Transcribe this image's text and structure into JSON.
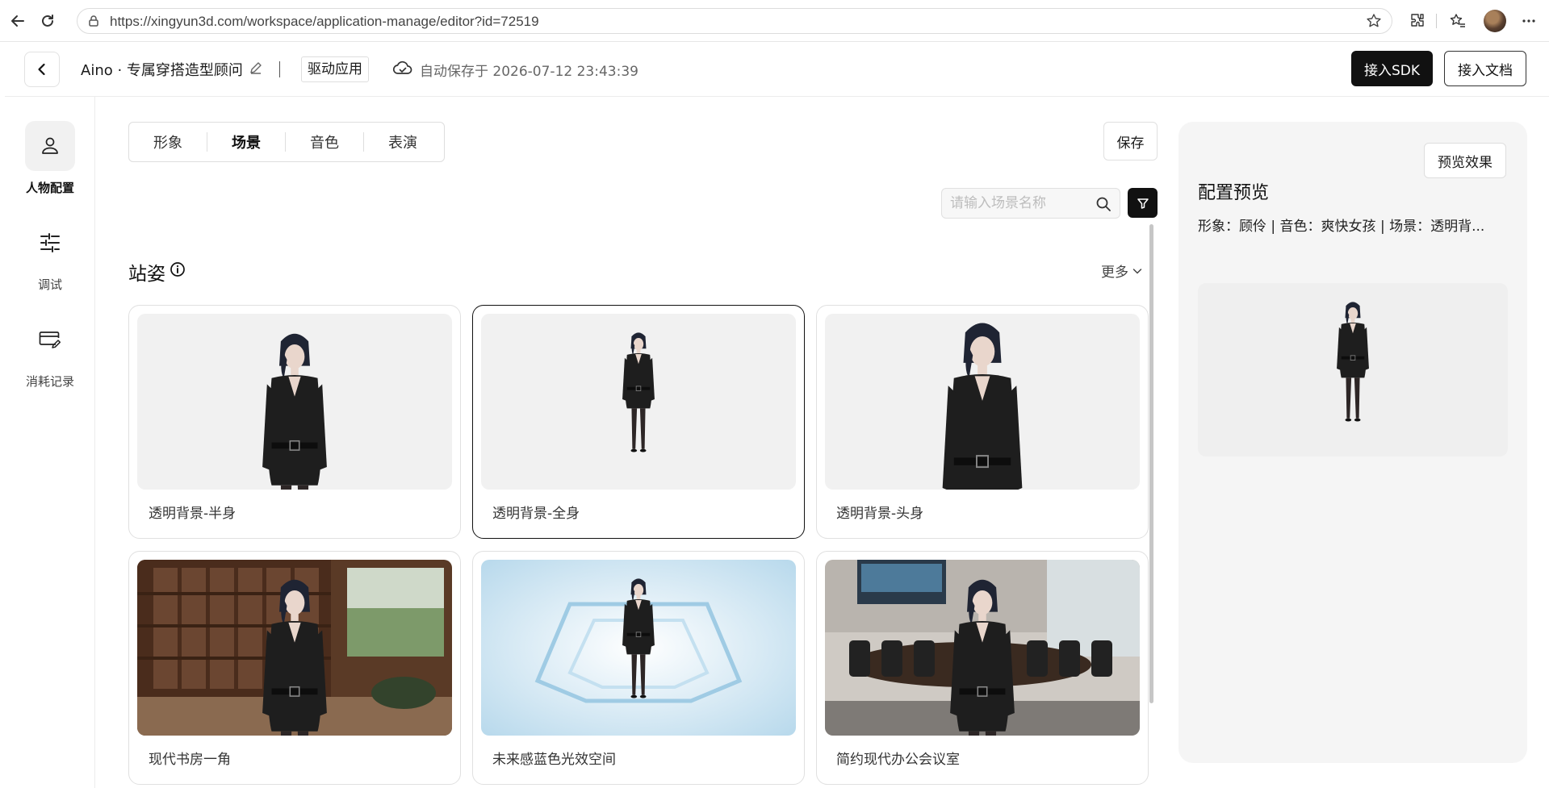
{
  "browser": {
    "url": "https://xingyun3d.com/workspace/application-manage/editor?id=72519"
  },
  "header": {
    "title": "Aino · 专属穿搭造型顾问",
    "drive_tag": "驱动应用",
    "autosave": "自动保存于 2026-07-12 23:43:39",
    "sdk_button": "接入SDK",
    "doc_button": "接入文档"
  },
  "sidebar": {
    "items": [
      {
        "label": "人物配置",
        "icon": "person-icon",
        "active": true
      },
      {
        "label": "调试",
        "icon": "sliders-icon",
        "active": false
      },
      {
        "label": "消耗记录",
        "icon": "card-edit-icon",
        "active": false
      }
    ]
  },
  "tabs": [
    {
      "label": "形象",
      "active": false
    },
    {
      "label": "场景",
      "active": true
    },
    {
      "label": "音色",
      "active": false
    },
    {
      "label": "表演",
      "active": false
    }
  ],
  "toolbar": {
    "save_label": "保存"
  },
  "search": {
    "placeholder": "请输入场景名称"
  },
  "section": {
    "title": "站姿",
    "more_label": "更多"
  },
  "scenes": [
    {
      "label": "透明背景-半身",
      "selected": false,
      "background": "transparent",
      "framing": "half"
    },
    {
      "label": "透明背景-全身",
      "selected": true,
      "background": "transparent",
      "framing": "full"
    },
    {
      "label": "透明背景-头身",
      "selected": false,
      "background": "transparent",
      "framing": "head"
    },
    {
      "label": "现代书房一角",
      "selected": false,
      "background": "study",
      "framing": "half"
    },
    {
      "label": "未来感蓝色光效空间",
      "selected": false,
      "background": "blue-light",
      "framing": "full"
    },
    {
      "label": "简约现代办公会议室",
      "selected": false,
      "background": "meeting-room",
      "framing": "half"
    }
  ],
  "preview": {
    "button": "预览效果",
    "title": "配置预览",
    "info": "形象：顾伶 | 音色：爽快女孩 | 场景：透明背..."
  },
  "colors": {
    "primary_dark": "#111111",
    "panel_bg": "#f5f5f5",
    "border": "#e0e0e0"
  }
}
